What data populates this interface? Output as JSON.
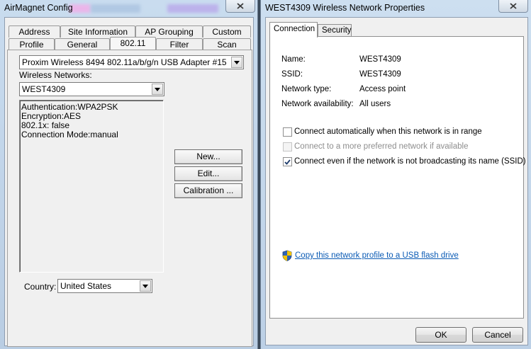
{
  "left_window": {
    "title": "AirMagnet Config",
    "tabs_row1": [
      "Address",
      "Site Information",
      "AP Grouping",
      "Custom"
    ],
    "tabs_row2": [
      "Profile",
      "General",
      "802.11",
      "Filter",
      "Scan"
    ],
    "active_tab": "802.11",
    "adapter": "Proxim Wireless 8494 802.11a/b/g/n USB Adapter #15",
    "wireless_networks_label": "Wireless Networks:",
    "selected_network": "WEST4309",
    "network_info": [
      "Authentication:WPA2PSK",
      "Encryption:AES",
      "802.1x: false",
      "Connection Mode:manual"
    ],
    "buttons": {
      "new": "New...",
      "edit": "Edit...",
      "calibration": "Calibration ..."
    },
    "country_label": "Country:",
    "country_value": "United States"
  },
  "right_window": {
    "title": "WEST4309 Wireless Network Properties",
    "tabs": [
      "Connection",
      "Security"
    ],
    "active_tab": "Connection",
    "fields": [
      {
        "label": "Name:",
        "value": "WEST4309"
      },
      {
        "label": "SSID:",
        "value": "WEST4309"
      },
      {
        "label": "Network type:",
        "value": "Access point"
      },
      {
        "label": "Network availability:",
        "value": "All users"
      }
    ],
    "checkboxes": [
      {
        "label": "Connect automatically when this network is in range",
        "checked": false,
        "enabled": true
      },
      {
        "label": "Connect to a more preferred network if available",
        "checked": false,
        "enabled": false
      },
      {
        "label": "Connect even if the network is not broadcasting its name (SSID)",
        "checked": true,
        "enabled": true
      }
    ],
    "link": "Copy this network profile to a USB flash drive",
    "buttons": {
      "ok": "OK",
      "cancel": "Cancel"
    }
  },
  "icons": {
    "close": "close-icon",
    "dropdown": "chevron-down-icon",
    "shield": "uac-shield-icon",
    "check": "check-icon"
  }
}
